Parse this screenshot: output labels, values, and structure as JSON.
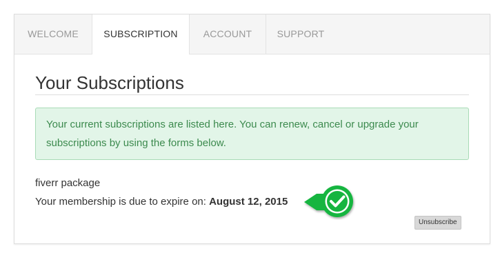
{
  "tabs": [
    {
      "label": "WELCOME"
    },
    {
      "label": "SUBSCRIPTION",
      "active": true
    },
    {
      "label": "ACCOUNT"
    },
    {
      "label": "SUPPORT"
    }
  ],
  "page_title": "Your Subscriptions",
  "alert": {
    "text": "Your current subscriptions are listed here. You can renew, cancel or upgrade your subscriptions by using the forms below."
  },
  "subscription": {
    "name": "fiverr package",
    "expire_label": "Your membership is due to expire on:",
    "expire_date": "August 12, 2015",
    "status_icon": "checkmark-icon"
  },
  "unsubscribe_label": "Unsubscribe",
  "colors": {
    "alert_bg": "#e2f5e8",
    "alert_text": "#3c8a4e",
    "check_green": "#19b540"
  }
}
